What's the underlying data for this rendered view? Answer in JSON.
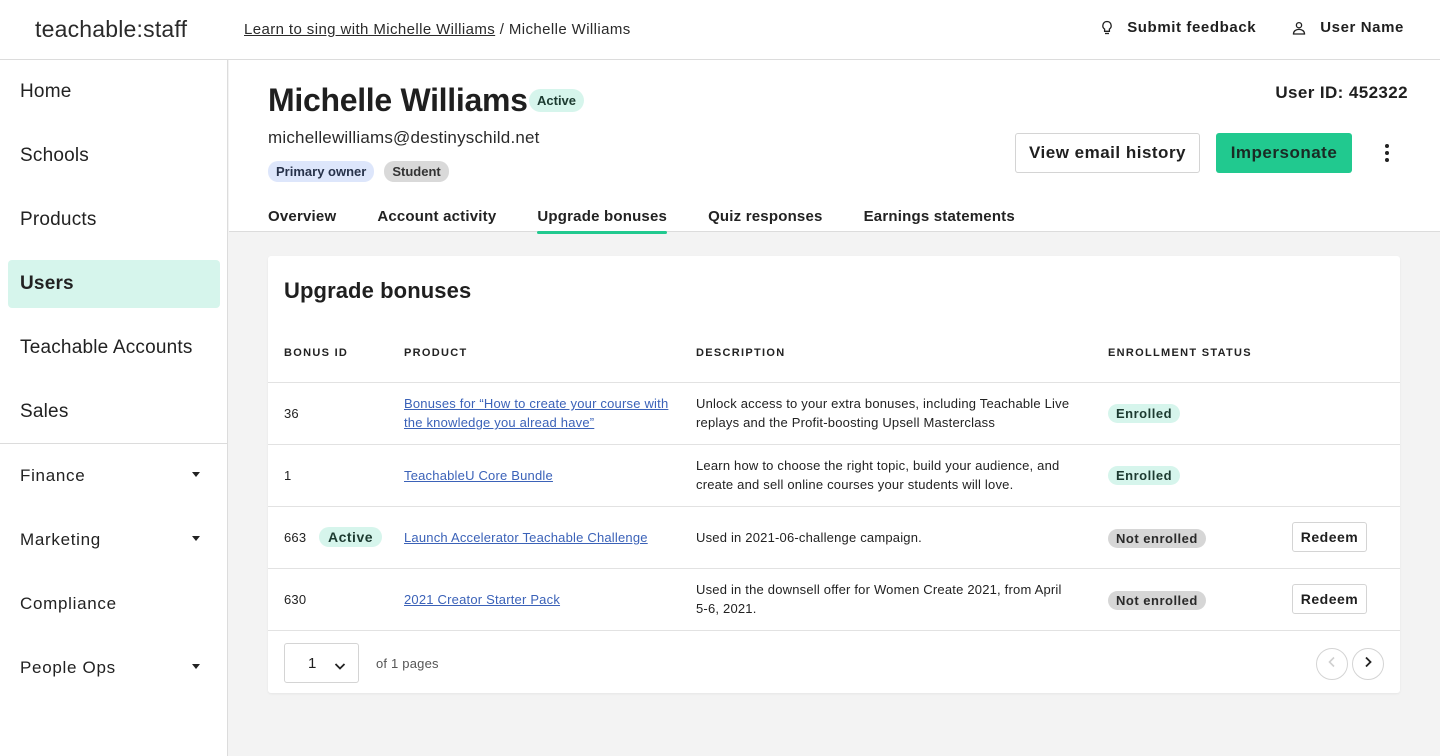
{
  "app": {
    "logo": "teachable:staff"
  },
  "breadcrumb": {
    "parent": "Learn to sing with Michelle Williams",
    "separator": " / ",
    "current": "Michelle Williams"
  },
  "topbar": {
    "feedback_label": "Submit feedback",
    "user_label": "User Name"
  },
  "sidebar": {
    "items": [
      {
        "label": "Home"
      },
      {
        "label": "Schools"
      },
      {
        "label": "Products"
      },
      {
        "label": "Users"
      },
      {
        "label": "Teachable Accounts"
      },
      {
        "label": "Sales"
      },
      {
        "label": "Finance"
      },
      {
        "label": "Marketing"
      },
      {
        "label": "Compliance"
      },
      {
        "label": "People Ops"
      }
    ],
    "active": "Users"
  },
  "user": {
    "name": "Michelle Williams",
    "status": "Active",
    "email": "michellewilliams@destinyschild.net",
    "roles": [
      "Primary owner",
      "Student"
    ],
    "id_label": "User ID: 452322"
  },
  "actions": {
    "view_email": "View email history",
    "impersonate": "Impersonate"
  },
  "tabs": [
    {
      "label": "Overview"
    },
    {
      "label": "Account activity"
    },
    {
      "label": "Upgrade bonuses"
    },
    {
      "label": "Quiz responses"
    },
    {
      "label": "Earnings statements"
    }
  ],
  "active_tab": "Upgrade bonuses",
  "card": {
    "title": "Upgrade bonuses",
    "columns": [
      "BONUS ID",
      "PRODUCT",
      "DESCRIPTION",
      "ENROLLMENT STATUS"
    ],
    "rows": [
      {
        "id": "36",
        "id_badge": "",
        "product": "Bonuses for “How to create your course with the knowledge you alread have”",
        "description": "Unlock access to your extra bonuses, including Teachable Live replays and the Profit-boosting Upsell Masterclass",
        "status": "Enrolled",
        "action": ""
      },
      {
        "id": "1",
        "id_badge": "",
        "product": "TeachableU Core Bundle",
        "description": "Learn how to choose the right topic, build your audience, and create and sell online courses your students will love.",
        "status": "Enrolled",
        "action": ""
      },
      {
        "id": "663",
        "id_badge": "Active",
        "product": "Launch Accelerator Teachable Challenge",
        "description": "Used in 2021-06-challenge campaign.",
        "status": "Not enrolled",
        "action": "Redeem"
      },
      {
        "id": "630",
        "id_badge": "",
        "product": "2021 Creator Starter Pack",
        "description": "Used in the downsell offer for Women Create 2021, from April 5-6, 2021.",
        "status": "Not enrolled",
        "action": "Redeem"
      }
    ]
  },
  "pagination": {
    "current": "1",
    "of_label": "of 1 pages"
  },
  "colors": {
    "accent": "#21c98f",
    "active_bg": "#d6f5ec",
    "link": "#3b62b8"
  }
}
